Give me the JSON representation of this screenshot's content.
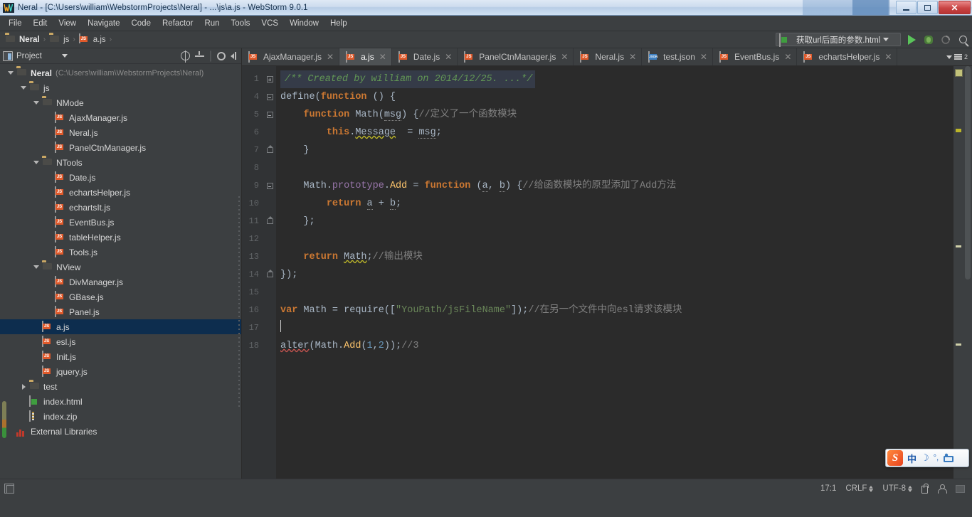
{
  "window": {
    "title": "Neral - [C:\\Users\\william\\WebstormProjects\\Neral] - ...\\js\\a.js - WebStorm 9.0.1",
    "minimize_label": "Minimize",
    "restore_label": "Restore",
    "close_label": "✕"
  },
  "menubar": {
    "items": [
      {
        "label": "File"
      },
      {
        "label": "Edit"
      },
      {
        "label": "View"
      },
      {
        "label": "Navigate"
      },
      {
        "label": "Code"
      },
      {
        "label": "Refactor"
      },
      {
        "label": "Run"
      },
      {
        "label": "Tools"
      },
      {
        "label": "VCS"
      },
      {
        "label": "Window"
      },
      {
        "label": "Help"
      }
    ]
  },
  "navbar": {
    "breadcrumb": [
      {
        "label": "Neral",
        "icon": "folder-icon"
      },
      {
        "label": "js",
        "icon": "folder-icon"
      },
      {
        "label": "a.js",
        "icon": "js-file-icon"
      }
    ],
    "separator": "›",
    "run_config": "获取url后面的参数.html",
    "run_button": "run-icon",
    "debug_button": "debug-icon",
    "coverage_button": "coverage-icon",
    "search_button": "search-icon"
  },
  "project_panel": {
    "title": "Project",
    "dropdown": "▾",
    "actions": [
      {
        "name": "locate-icon"
      },
      {
        "name": "collapse-all-icon"
      },
      {
        "name": "gear-icon"
      },
      {
        "name": "hide-panel-icon"
      }
    ],
    "tree": [
      {
        "depth": 0,
        "twist": "down",
        "icon": "folder-icon",
        "label": "Neral",
        "path": "(C:\\Users\\william\\WebstormProjects\\Neral)",
        "bold": true
      },
      {
        "depth": 1,
        "twist": "down",
        "icon": "folder-icon",
        "label": "js"
      },
      {
        "depth": 2,
        "twist": "down",
        "icon": "folder-icon",
        "label": "NMode"
      },
      {
        "depth": 3,
        "twist": "none",
        "icon": "js-file-icon",
        "label": "AjaxManager.js"
      },
      {
        "depth": 3,
        "twist": "none",
        "icon": "js-file-icon",
        "label": "Neral.js"
      },
      {
        "depth": 3,
        "twist": "none",
        "icon": "js-file-icon",
        "label": "PanelCtnManager.js"
      },
      {
        "depth": 2,
        "twist": "down",
        "icon": "folder-icon",
        "label": "NTools"
      },
      {
        "depth": 3,
        "twist": "none",
        "icon": "js-file-icon",
        "label": "Date.js"
      },
      {
        "depth": 3,
        "twist": "none",
        "icon": "js-file-icon",
        "label": "echartsHelper.js"
      },
      {
        "depth": 3,
        "twist": "none",
        "icon": "js-file-icon",
        "label": "echartsIt.js"
      },
      {
        "depth": 3,
        "twist": "none",
        "icon": "js-file-icon",
        "label": "EventBus.js"
      },
      {
        "depth": 3,
        "twist": "none",
        "icon": "js-file-icon",
        "label": "tableHelper.js"
      },
      {
        "depth": 3,
        "twist": "none",
        "icon": "js-file-icon",
        "label": "Tools.js"
      },
      {
        "depth": 2,
        "twist": "down",
        "icon": "folder-icon",
        "label": "NView"
      },
      {
        "depth": 3,
        "twist": "none",
        "icon": "js-file-icon",
        "label": "DivManager.js"
      },
      {
        "depth": 3,
        "twist": "none",
        "icon": "js-file-icon",
        "label": "GBase.js"
      },
      {
        "depth": 3,
        "twist": "none",
        "icon": "js-file-icon",
        "label": "Panel.js"
      },
      {
        "depth": 2,
        "twist": "none",
        "icon": "js-file-icon",
        "label": "a.js",
        "selected": true
      },
      {
        "depth": 2,
        "twist": "none",
        "icon": "js-file-icon",
        "label": "esl.js"
      },
      {
        "depth": 2,
        "twist": "none",
        "icon": "js-file-icon",
        "label": "Init.js"
      },
      {
        "depth": 2,
        "twist": "none",
        "icon": "js-file-icon",
        "label": "jquery.js"
      },
      {
        "depth": 1,
        "twist": "right",
        "icon": "folder-icon",
        "label": "test"
      },
      {
        "depth": 1,
        "twist": "none",
        "icon": "html-file-icon",
        "label": "index.html"
      },
      {
        "depth": 1,
        "twist": "none",
        "icon": "zip-file-icon",
        "label": "index.zip"
      },
      {
        "depth": 0,
        "twist": "none",
        "icon": "library-icon",
        "label": "External Libraries"
      }
    ]
  },
  "editor": {
    "tabs": [
      {
        "label": "AjaxManager.js",
        "icon": "js-file-icon",
        "active": false
      },
      {
        "label": "a.js",
        "icon": "js-file-icon",
        "active": true
      },
      {
        "label": "Date.js",
        "icon": "js-file-icon",
        "active": false
      },
      {
        "label": "PanelCtnManager.js",
        "icon": "js-file-icon",
        "active": false
      },
      {
        "label": "Neral.js",
        "icon": "js-file-icon",
        "active": false
      },
      {
        "label": "test.json",
        "icon": "json-file-icon",
        "active": false
      },
      {
        "label": "EventBus.js",
        "icon": "js-file-icon",
        "active": false
      },
      {
        "label": "echartsHelper.js",
        "icon": "js-file-icon",
        "active": false
      }
    ],
    "tab_close": "✕",
    "tab_overflow_badge": "2",
    "line_numbers": [
      "1",
      "4",
      "5",
      "6",
      "7",
      "8",
      "9",
      "10",
      "11",
      "12",
      "13",
      "14",
      "15",
      "16",
      "17",
      "18"
    ],
    "code_lines": [
      "/** Created by william on 2014/12/25. ...*/",
      "define(function () {",
      "    function Math(msg) {//定义了一个函数模块",
      "        this.Message  = msg;",
      "    }",
      "",
      "    Math.prototype.Add = function (a, b) {//给函数模块的原型添加了Add方法",
      "        return a + b;",
      "    };",
      "",
      "    return Math;//输出模块",
      "});",
      "",
      "var Math = require([\"YouPath/jsFileName\"]);//在另一个文件中向esl请求该模块",
      "",
      "alter(Math.Add(1,2));//3"
    ]
  },
  "ime": {
    "logo": "S",
    "mode": "中",
    "moon": "☽",
    "punct": "°,",
    "keyboard": "keyboard-icon"
  },
  "statusbar": {
    "toggle_panels": "toggle-panels-icon",
    "caret_position": "17:1",
    "line_separator": "CRLF",
    "encoding": "UTF-8",
    "lock": "lock-icon",
    "person": "person-icon",
    "block": "memory-block-icon"
  },
  "colors": {
    "ide_bg": "#3c3f41",
    "editor_bg": "#2b2b2b",
    "gutter_bg": "#313335",
    "selection": "#0d2d4e",
    "active_tab": "#4e5254",
    "keyword": "#cc7832",
    "function": "#ffc66d",
    "string": "#6a8759",
    "number": "#6897bb",
    "comment": "#808080",
    "docblock": "#629755",
    "text": "#a9b7c6",
    "accent_js": "#e05a2b",
    "folder": "#c9a764",
    "run_green": "#5ac45a"
  }
}
